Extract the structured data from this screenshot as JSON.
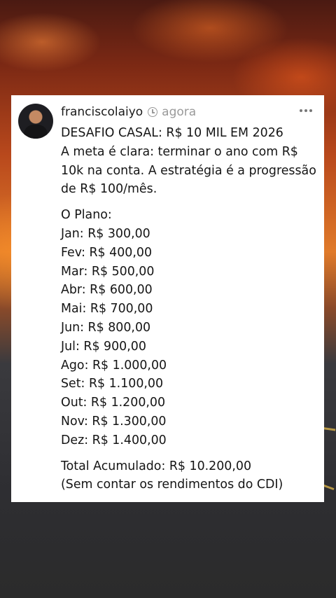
{
  "post": {
    "username": "franciscolaiyo",
    "time": "agora",
    "title": "DESAFIO CASAL: R$ 10 MIL EM 2026",
    "intro": [
      "A meta é clara: terminar o ano com R$",
      "10k na conta. A estratégia é a progressão",
      "de R$ 100/mês."
    ],
    "plan_heading": "O Plano:",
    "plan": [
      "Jan: R$ 300,00",
      "Fev: R$ 400,00",
      "Mar: R$ 500,00",
      "Abr: R$ 600,00",
      "Mai: R$ 700,00",
      "Jun: R$ 800,00",
      "Jul: R$ 900,00",
      "Ago: R$ 1.000,00",
      "Set: R$ 1.100,00",
      "Out: R$ 1.200,00",
      "Nov: R$ 1.300,00",
      "Dez: R$ 1.400,00"
    ],
    "total": "Total Acumulado: R$ 10.200,00",
    "note": "(Sem contar os rendimentos do CDI)"
  },
  "icons": {
    "clock": "clock-icon",
    "more": "more-options-icon"
  }
}
